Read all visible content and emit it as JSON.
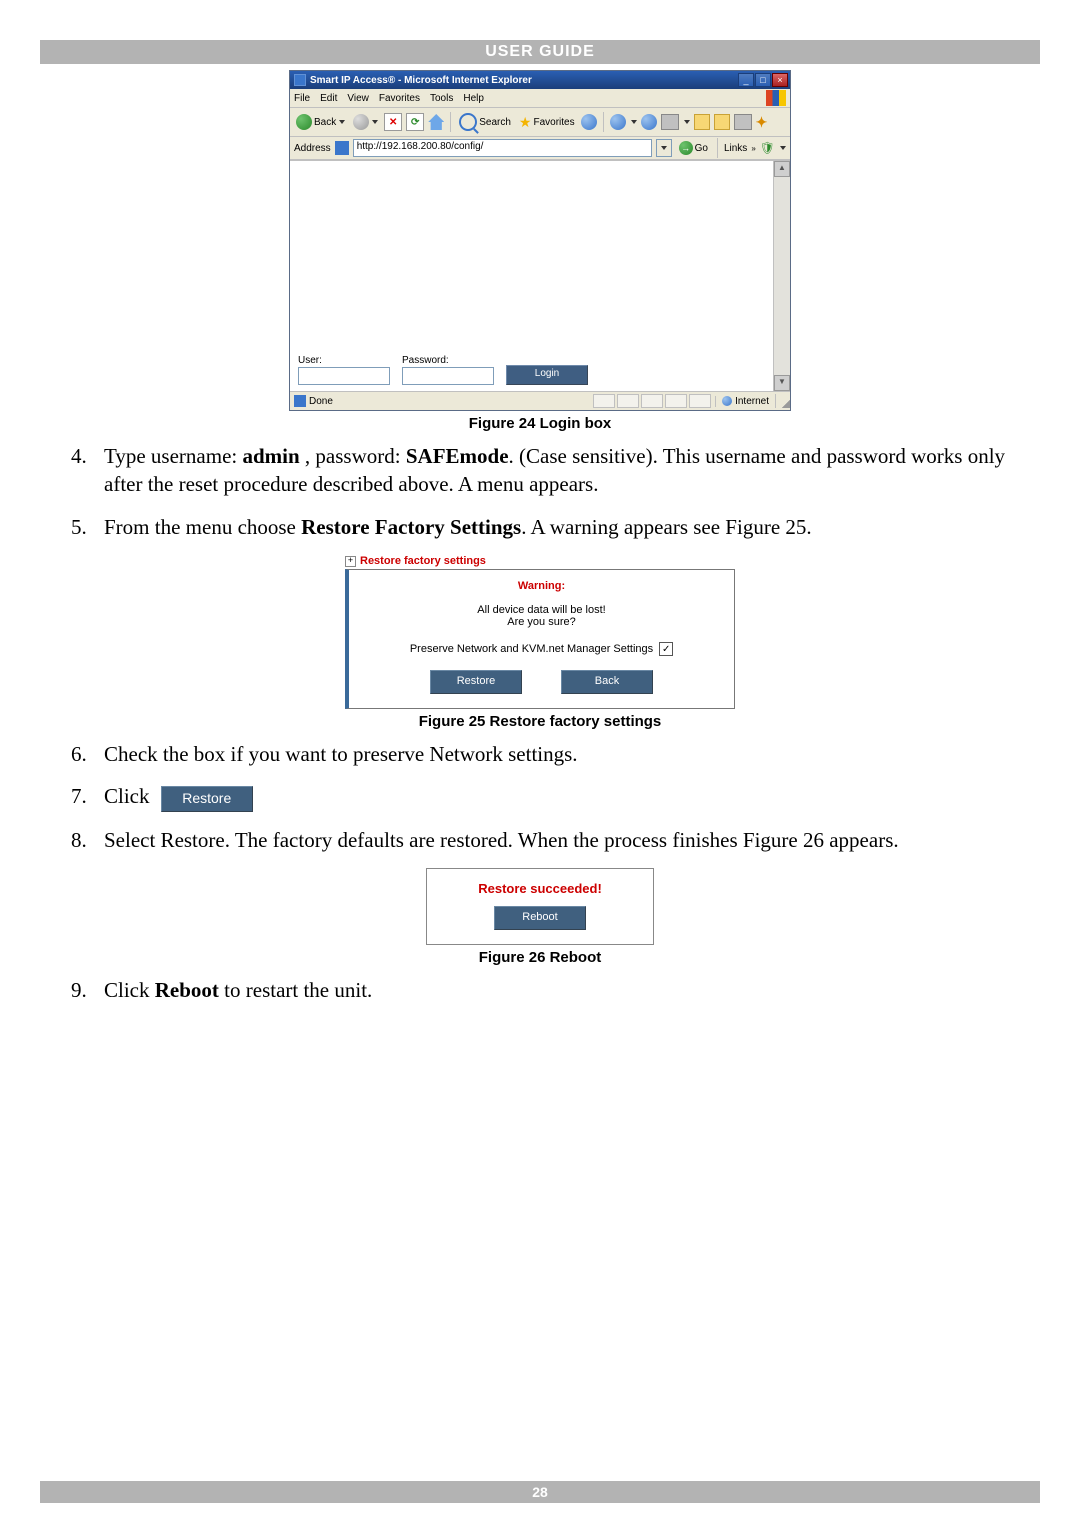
{
  "header": {
    "title": "USER GUIDE"
  },
  "footer": {
    "page_number": "28"
  },
  "ie": {
    "title": "Smart IP Access® - Microsoft Internet Explorer",
    "menus": [
      "File",
      "Edit",
      "View",
      "Favorites",
      "Tools",
      "Help"
    ],
    "toolbar": {
      "back": "Back",
      "search": "Search",
      "favorites": "Favorites"
    },
    "address_label": "Address",
    "address_value": "http://192.168.200.80/config/",
    "go": "Go",
    "links": "Links",
    "login": {
      "user_label": "User:",
      "password_label": "Password:",
      "login_btn": "Login"
    },
    "status_done": "Done",
    "status_zone": "Internet"
  },
  "captions": {
    "fig24": "Figure 24 Login box",
    "fig25": "Figure 25 Restore factory settings",
    "fig26": "Figure 26 Reboot"
  },
  "steps": {
    "s4_a": "Type username: ",
    "s4_admin": "admin",
    "s4_b": " , password: ",
    "s4_safemode": "SAFEmode",
    "s4_c": ". (Case sensitive). This username and password works only after the reset procedure described above. A menu appears.",
    "s5_a": "From the menu choose ",
    "s5_b": "Restore Factory Settings",
    "s5_c": ". A warning appears see Figure 25.",
    "s6": "Check the box if you want to preserve Network settings.",
    "s7": "Click ",
    "s8": "Select Restore. The factory defaults are restored. When the process finishes Figure 26 appears.",
    "s9_a": "Click ",
    "s9_b": "Reboot",
    "s9_c": " to restart the unit."
  },
  "fig25": {
    "tree_title": "Restore factory settings",
    "warning": "Warning:",
    "line1": "All device data will be lost!",
    "line2": "Are you sure?",
    "preserve": "Preserve Network and KVM.net Manager Settings",
    "restore_btn": "Restore",
    "back_btn": "Back"
  },
  "fig26": {
    "succeed": "Restore succeeded!",
    "reboot_btn": "Reboot"
  },
  "inline_restore_btn": "Restore"
}
